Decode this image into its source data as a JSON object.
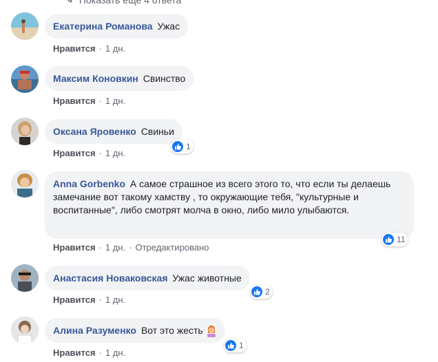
{
  "more_replies": {
    "label": "Показать еще 4 ответа"
  },
  "actions": {
    "like_label": "Нравится",
    "separator": "·"
  },
  "comments": [
    {
      "author": "Екатерина Романова",
      "text": "Ужас",
      "time": "1 дн.",
      "edited": "",
      "reactions": ""
    },
    {
      "author": "Максим Коновкин",
      "text": "Свинство",
      "time": "1 дн.",
      "edited": "",
      "reactions": ""
    },
    {
      "author": "Оксана Яровенко",
      "text": "Свиньи",
      "time": "1 дн.",
      "edited": "",
      "reactions": "1"
    },
    {
      "author": "Anna Gorbenko",
      "text": "А самое страшное из всего этого то, что если ты делаешь замечание вот такому хамству , то окружающие тебя, \"культурные и воспитанные\", либо смотрят молча в окно, либо мило улыбаются.",
      "time": "1 дн.",
      "edited": "Отредактировано",
      "reactions": "11"
    },
    {
      "author": "Анастасия Новаковская",
      "text": "Ужас животные",
      "time": "1 дн.",
      "edited": "",
      "reactions": "2"
    },
    {
      "author": "Алина Разуменко",
      "text": "Вот это жесть",
      "time": "1 дн.",
      "edited": "",
      "reactions": "1"
    }
  ],
  "colors": {
    "author": "#385898",
    "bubble": "#f2f3f5",
    "like_blue": "#1877f2",
    "meta": "#606770"
  }
}
